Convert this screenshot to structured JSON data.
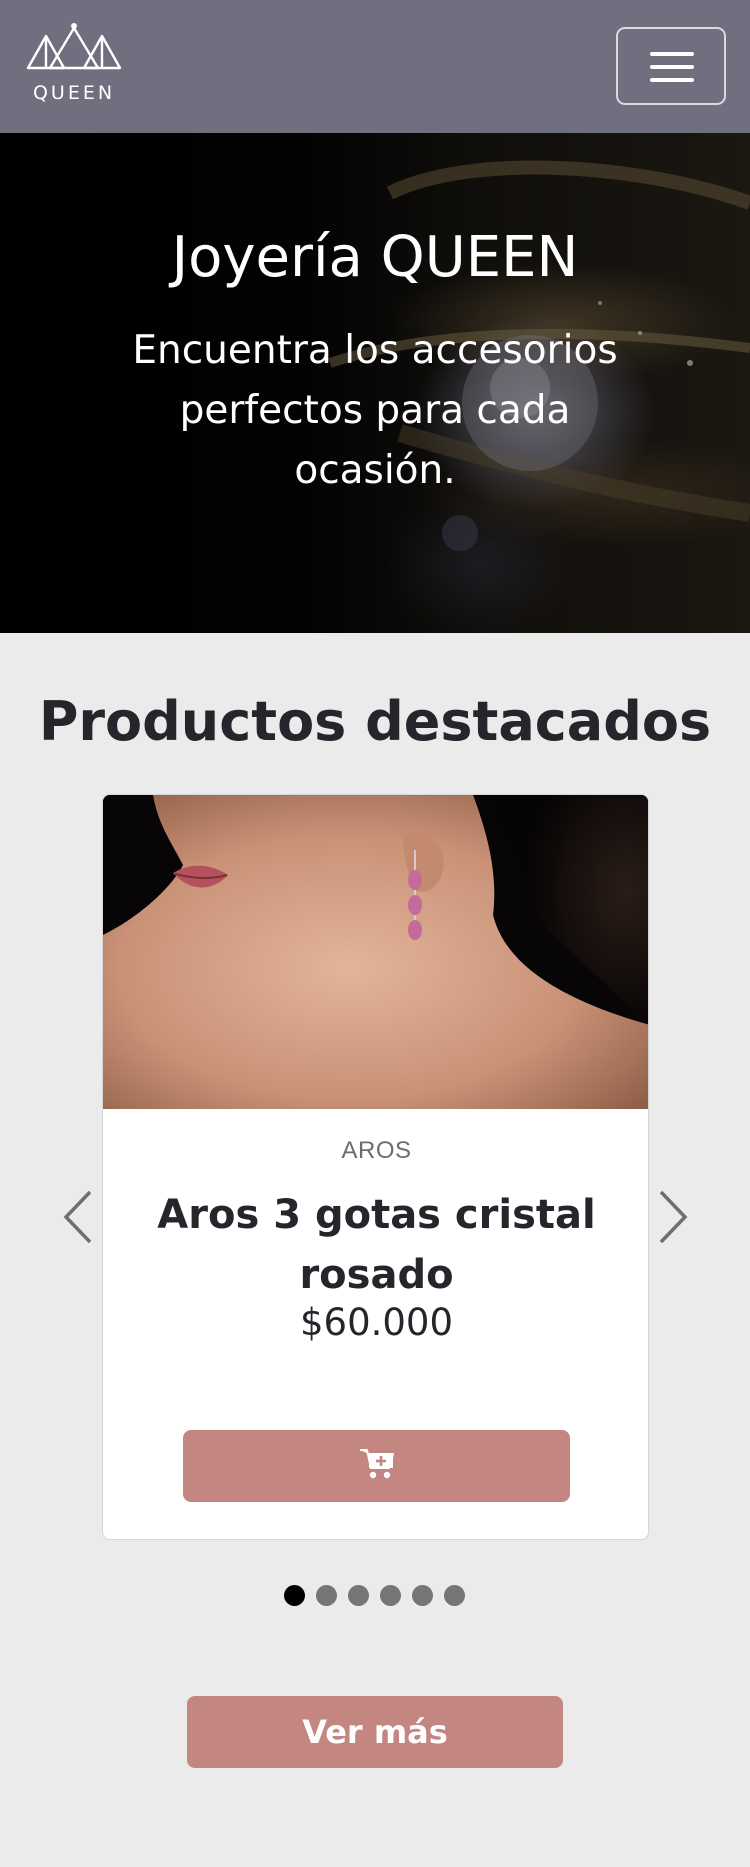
{
  "brand": {
    "logo_text": "QUEEN"
  },
  "navbar": {
    "background": "#6f6f7f",
    "menu_icon": "hamburger-icon"
  },
  "hero": {
    "title": "Joyería QUEEN",
    "subtitle": "Encuentra los accesorios perfectos para cada ocasión."
  },
  "featured": {
    "title": "Productos destacados",
    "product": {
      "category": "AROS",
      "name": "Aros 3 gotas cristal rosado",
      "price": "$60.000",
      "cart_icon": "cart-plus-icon"
    },
    "carousel": {
      "prev_icon": "chevron-left-icon",
      "next_icon": "chevron-right-icon",
      "slide_count": 6,
      "active_slide": 1
    },
    "see_more_label": "Ver más"
  },
  "colors": {
    "accent": "#c38680",
    "text_dark": "#25262b",
    "page_background": "#ebebeb"
  }
}
